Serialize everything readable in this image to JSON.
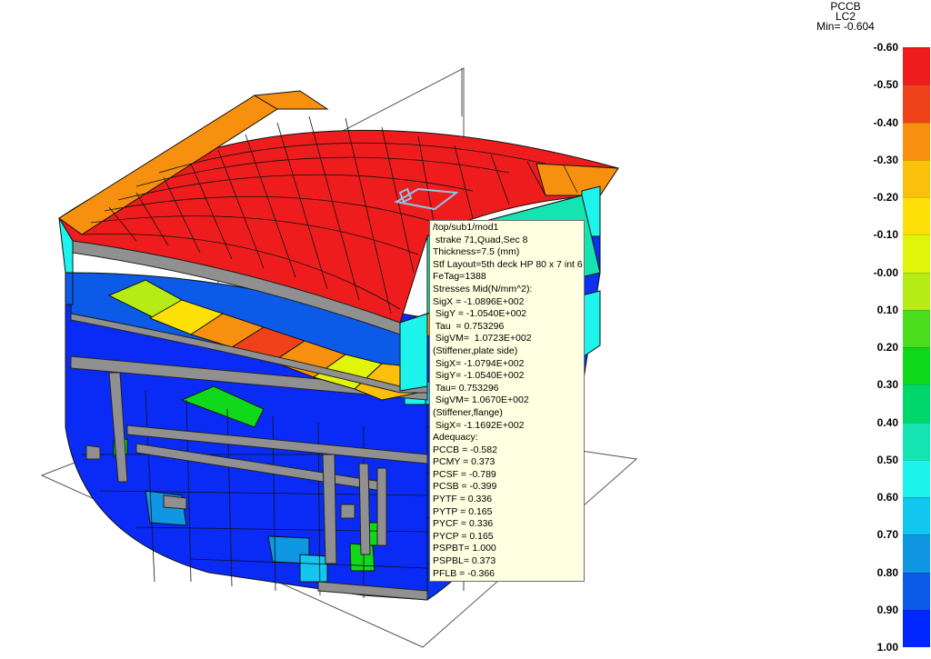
{
  "legend": {
    "title": "PCCB",
    "load_case": "LC2",
    "min_label": "Min= -0.604",
    "labels": [
      "-0.60",
      "-0.50",
      "-0.40",
      "-0.30",
      "-0.20",
      "-0.10",
      "-0.00",
      "0.10",
      "0.20",
      "0.30",
      "0.40",
      "0.50",
      "0.60",
      "0.70",
      "0.80",
      "0.90",
      "1.00"
    ],
    "colors": [
      "#ee1c1c",
      "#f0421a",
      "#f7900e",
      "#fbc00b",
      "#fde007",
      "#e1f50a",
      "#b6ec16",
      "#4bdc1d",
      "#10d81a",
      "#00d76b",
      "#16e3b2",
      "#1ef3ec",
      "#12c6ef",
      "#1097e3",
      "#0b5ae8",
      "#0026ff"
    ]
  },
  "tooltip": {
    "lines": [
      "/top/sub1/mod1",
      " strake 71,Quad,Sec 8",
      "Thickness=7.5 (mm)",
      "Stf Layout=5th deck HP 80 x 7 int 6",
      "FeTag=1388",
      "Stresses Mid(N/mm^2):",
      "SigX = -1.0896E+002",
      " SigY = -1.0540E+002",
      " Tau  = 0.753296",
      " SigVM=  1.0723E+002",
      "(Stiffener,plate side)",
      " SigX= -1.0794E+002",
      " SigY= -1.0540E+002",
      " Tau= 0.753296",
      " SigVM= 1.0670E+002",
      "(Stiffener,flange)",
      " SigX= -1.1692E+002",
      "Adequacy:",
      "PCCB = -0.582",
      "PCMY = 0.373",
      "PCSF = -0.789",
      "PCSB = -0.399",
      "PYTF = 0.336",
      "PYTP = 0.165",
      "PYCF = 0.336",
      "PYCP = 0.165",
      "PSPBT= 1.000",
      "PSPBL= 0.373",
      "PFLB = -0.366"
    ]
  }
}
